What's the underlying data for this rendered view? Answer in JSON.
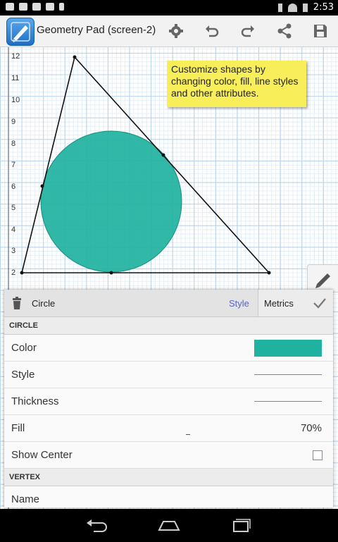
{
  "status_bar": {
    "time": "2:53"
  },
  "action_bar": {
    "title": "Geometry Pad (screen-2)",
    "icons": [
      "app-icon",
      "gear-icon",
      "undo-icon",
      "redo-icon",
      "share-icon",
      "save-icon"
    ]
  },
  "canvas": {
    "y_ticks": [
      "12",
      "11",
      "10",
      "9",
      "8",
      "7",
      "6",
      "5",
      "4",
      "3",
      "2"
    ],
    "tooltip_text": "Customize shapes by changing color, fill, line styles and other attributes.",
    "shape_color": "#20b2a0"
  },
  "panel": {
    "shape_name": "Circle",
    "tab_style": "Style",
    "tab_metrics": "Metrics",
    "section_circle": "CIRCLE",
    "rows": {
      "color_label": "Color",
      "color_value": "#20b2a0",
      "style_label": "Style",
      "thickness_label": "Thickness",
      "fill_label": "Fill",
      "fill_value": "70%",
      "show_center_label": "Show Center",
      "show_center_checked": false
    },
    "section_vertex": "VERTEX",
    "vertex_name_label": "Name"
  }
}
